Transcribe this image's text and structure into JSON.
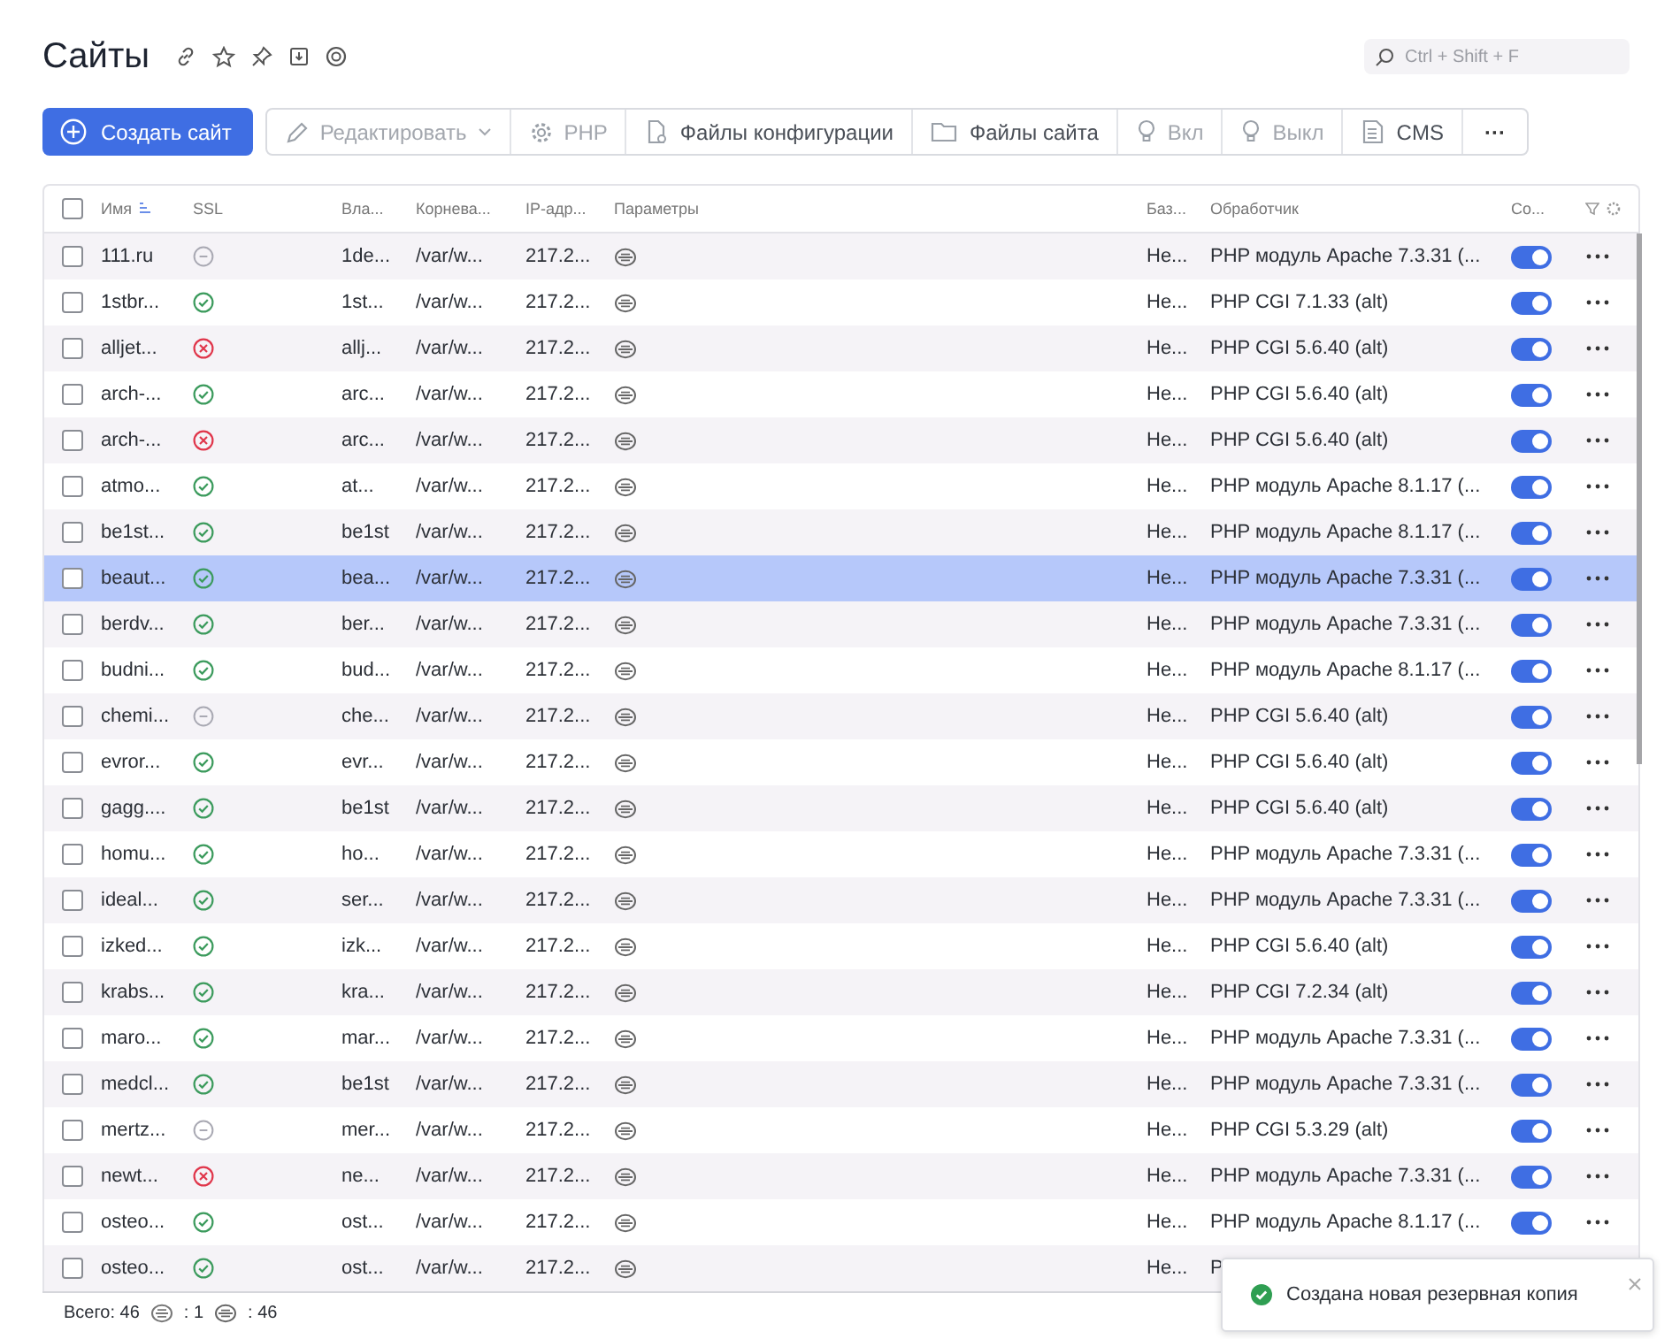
{
  "page": {
    "title": "Сайты"
  },
  "search": {
    "placeholder": "Ctrl + Shift + F"
  },
  "toolbar": {
    "create_button": "Создать сайт",
    "buttons": [
      {
        "kind": "edit",
        "label": "Редактировать",
        "disabled": true
      },
      {
        "kind": "gear",
        "label": "PHP",
        "disabled": true
      },
      {
        "kind": "file",
        "label": "Файлы конфигурации",
        "disabled": false
      },
      {
        "kind": "folder",
        "label": "Файлы сайта",
        "disabled": false
      },
      {
        "kind": "bulb",
        "label": "Вкл",
        "disabled": true
      },
      {
        "kind": "bulb",
        "label": "Выкл",
        "disabled": true
      },
      {
        "kind": "doc",
        "label": "CMS",
        "disabled": false
      }
    ],
    "more_button": "···"
  },
  "table": {
    "all_checked": false,
    "columns": [
      "Имя",
      "SSL",
      "Вла...",
      "Корнева...",
      "IP-адр...",
      "Параметры",
      "Баз...",
      "Обработчик",
      "Со..."
    ],
    "rows": [
      {
        "checked": false,
        "selected": false,
        "name": "111.ru",
        "ssl": {
          "kind": "none"
        },
        "owner": "1de...",
        "root": "/var/w...",
        "ip": "217.2...",
        "base": "Не...",
        "handler": "PHP модуль Apache 7.3.31 (...",
        "on": true
      },
      {
        "checked": false,
        "selected": false,
        "name": "1stbr...",
        "ssl": {
          "kind": "ok"
        },
        "owner": "1st...",
        "root": "/var/w...",
        "ip": "217.2...",
        "base": "Не...",
        "handler": "PHP CGI 7.1.33 (alt)",
        "on": true
      },
      {
        "checked": false,
        "selected": false,
        "name": "alljet...",
        "ssl": {
          "kind": "error"
        },
        "owner": "allj...",
        "root": "/var/w...",
        "ip": "217.2...",
        "base": "Не...",
        "handler": "PHP CGI 5.6.40 (alt)",
        "on": true
      },
      {
        "checked": false,
        "selected": false,
        "name": "arch-...",
        "ssl": {
          "kind": "ok"
        },
        "owner": "arc...",
        "root": "/var/w...",
        "ip": "217.2...",
        "base": "Не...",
        "handler": "PHP CGI 5.6.40 (alt)",
        "on": true
      },
      {
        "checked": false,
        "selected": false,
        "name": "arch-...",
        "ssl": {
          "kind": "error"
        },
        "owner": "arc...",
        "root": "/var/w...",
        "ip": "217.2...",
        "base": "Не...",
        "handler": "PHP CGI 5.6.40 (alt)",
        "on": true
      },
      {
        "checked": false,
        "selected": false,
        "name": "atmo...",
        "ssl": {
          "kind": "ok"
        },
        "owner": "at...",
        "root": "/var/w...",
        "ip": "217.2...",
        "base": "Не...",
        "handler": "PHP модуль Apache 8.1.17 (...",
        "on": true
      },
      {
        "checked": false,
        "selected": false,
        "name": "be1st...",
        "ssl": {
          "kind": "ok"
        },
        "owner": "be1st",
        "root": "/var/w...",
        "ip": "217.2...",
        "base": "Не...",
        "handler": "PHP модуль Apache 8.1.17 (...",
        "on": true
      },
      {
        "checked": false,
        "selected": true,
        "name": "beaut...",
        "ssl": {
          "kind": "ok"
        },
        "owner": "bea...",
        "root": "/var/w...",
        "ip": "217.2...",
        "base": "Не...",
        "handler": "PHP модуль Apache 7.3.31 (...",
        "on": true
      },
      {
        "checked": false,
        "selected": false,
        "name": "berdv...",
        "ssl": {
          "kind": "ok"
        },
        "owner": "ber...",
        "root": "/var/w...",
        "ip": "217.2...",
        "base": "Не...",
        "handler": "PHP модуль Apache 7.3.31 (...",
        "on": true
      },
      {
        "checked": false,
        "selected": false,
        "name": "budni...",
        "ssl": {
          "kind": "ok"
        },
        "owner": "bud...",
        "root": "/var/w...",
        "ip": "217.2...",
        "base": "Не...",
        "handler": "PHP модуль Apache 8.1.17 (...",
        "on": true
      },
      {
        "checked": false,
        "selected": false,
        "name": "chemi...",
        "ssl": {
          "kind": "none"
        },
        "owner": "che...",
        "root": "/var/w...",
        "ip": "217.2...",
        "base": "Не...",
        "handler": "PHP CGI 5.6.40 (alt)",
        "on": true
      },
      {
        "checked": false,
        "selected": false,
        "name": "evror...",
        "ssl": {
          "kind": "ok"
        },
        "owner": "evr...",
        "root": "/var/w...",
        "ip": "217.2...",
        "base": "Не...",
        "handler": "PHP CGI 5.6.40 (alt)",
        "on": true
      },
      {
        "checked": false,
        "selected": false,
        "name": "gagg....",
        "ssl": {
          "kind": "ok"
        },
        "owner": "be1st",
        "root": "/var/w...",
        "ip": "217.2...",
        "base": "Не...",
        "handler": "PHP CGI 5.6.40 (alt)",
        "on": true
      },
      {
        "checked": false,
        "selected": false,
        "name": "homu...",
        "ssl": {
          "kind": "ok"
        },
        "owner": "ho...",
        "root": "/var/w...",
        "ip": "217.2...",
        "base": "Не...",
        "handler": "PHP модуль Apache 7.3.31 (...",
        "on": true
      },
      {
        "checked": false,
        "selected": false,
        "name": "ideal...",
        "ssl": {
          "kind": "ok"
        },
        "owner": "ser...",
        "root": "/var/w...",
        "ip": "217.2...",
        "base": "Не...",
        "handler": "PHP модуль Apache 7.3.31 (...",
        "on": true
      },
      {
        "checked": false,
        "selected": false,
        "name": "izked...",
        "ssl": {
          "kind": "ok"
        },
        "owner": "izk...",
        "root": "/var/w...",
        "ip": "217.2...",
        "base": "Не...",
        "handler": "PHP CGI 5.6.40 (alt)",
        "on": true
      },
      {
        "checked": false,
        "selected": false,
        "name": "krabs...",
        "ssl": {
          "kind": "ok"
        },
        "owner": "kra...",
        "root": "/var/w...",
        "ip": "217.2...",
        "base": "Не...",
        "handler": "PHP CGI 7.2.34 (alt)",
        "on": true
      },
      {
        "checked": false,
        "selected": false,
        "name": "maro...",
        "ssl": {
          "kind": "ok"
        },
        "owner": "mar...",
        "root": "/var/w...",
        "ip": "217.2...",
        "base": "Не...",
        "handler": "PHP модуль Apache 7.3.31 (...",
        "on": true
      },
      {
        "checked": false,
        "selected": false,
        "name": "medcl...",
        "ssl": {
          "kind": "ok"
        },
        "owner": "be1st",
        "root": "/var/w...",
        "ip": "217.2...",
        "base": "Не...",
        "handler": "PHP модуль Apache 7.3.31 (...",
        "on": true
      },
      {
        "checked": false,
        "selected": false,
        "name": "mertz...",
        "ssl": {
          "kind": "none"
        },
        "owner": "mer...",
        "root": "/var/w...",
        "ip": "217.2...",
        "base": "Не...",
        "handler": "PHP CGI 5.3.29 (alt)",
        "on": true
      },
      {
        "checked": false,
        "selected": false,
        "name": "newt...",
        "ssl": {
          "kind": "error"
        },
        "owner": "ne...",
        "root": "/var/w...",
        "ip": "217.2...",
        "base": "Не...",
        "handler": "PHP модуль Apache 7.3.31 (...",
        "on": true
      },
      {
        "checked": false,
        "selected": false,
        "name": "osteo...",
        "ssl": {
          "kind": "ok"
        },
        "owner": "ost...",
        "root": "/var/w...",
        "ip": "217.2...",
        "base": "Не...",
        "handler": "PHP модуль Apache 8.1.17 (...",
        "on": true
      },
      {
        "checked": false,
        "selected": false,
        "name": "osteo...",
        "ssl": {
          "kind": "ok"
        },
        "owner": "ost...",
        "root": "/var/w...",
        "ip": "217.2...",
        "base": "Не...",
        "handler": "P"
      }
    ]
  },
  "footer": {
    "total": "Всего: 46",
    "cgi_count": ": 1",
    "php_count": ": 46"
  },
  "toast": {
    "message": "Создана новая резервная копия"
  }
}
